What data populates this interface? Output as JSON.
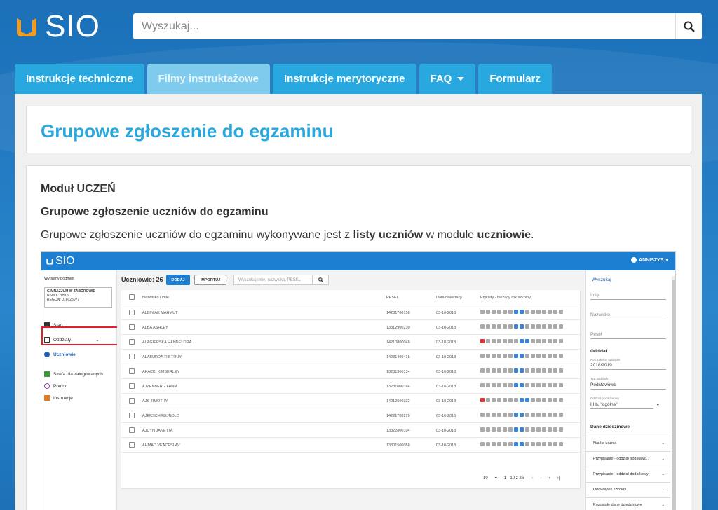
{
  "header": {
    "logo_text": "SIO",
    "search_placeholder": "Wyszukaj..."
  },
  "tabs": [
    {
      "label": "Instrukcje techniczne",
      "active": false
    },
    {
      "label": "Filmy instruktażowe",
      "active": true
    },
    {
      "label": "Instrukcje merytoryczne",
      "active": false
    },
    {
      "label": "FAQ",
      "active": false
    },
    {
      "label": "Formularz",
      "active": false
    }
  ],
  "page": {
    "title": "Grupowe zgłoszenie do egzaminu",
    "heading": "Moduł UCZEŃ",
    "subheading": "Grupowe zgłoszenie uczniów do egzaminu",
    "paragraph_start": "Grupowe zgłoszenie uczniów do egzaminu wykonywane jest z ",
    "paragraph_bold1": "listy uczniów",
    "paragraph_mid": " w module ",
    "paragraph_bold2": "uczniowie",
    "paragraph_end": "."
  },
  "screenshot": {
    "logo": "SIO",
    "user": "ANNISZYS",
    "side_label": "Wybrany podmiot",
    "school_name": "GIMNAZJUM W ZABOROWIE",
    "rspo": "RSPO: 20515",
    "regon": "REGON: 016025077",
    "nav": [
      "Start",
      "Oddziały",
      "Uczniowie",
      "Strefa dla zalogowanych",
      "Pomoc",
      "Instrukcje"
    ],
    "count": "Uczniowie: 26",
    "btn_add": "DODAJ",
    "btn_import": "IMPORTUJ",
    "search_placeholder": "Wyszukaj imię, nazwisko, PESEL",
    "columns": [
      "Nazwisko i imię",
      "PESEL",
      "Data rejestracji",
      "Etykiety - bieżący rok szkolny"
    ],
    "rows": [
      {
        "name": "ALBINIAK MAHMUT",
        "pesel": "14231700158",
        "date": "03-10-2018"
      },
      {
        "name": "ALBA ASHLEY",
        "pesel": "13312900230",
        "date": "03-10-2018"
      },
      {
        "name": "ALAGIERSKA HANNELORA",
        "pesel": "14210800048",
        "date": "03-10-2018"
      },
      {
        "name": "ALABURDA THI THUY",
        "pesel": "14231400416",
        "date": "03-10-2018"
      },
      {
        "name": "AKACKI KIMBERLEY",
        "pesel": "13281300134",
        "date": "03-10-2018"
      },
      {
        "name": "AJZENBERG FANIA",
        "pesel": "13281000164",
        "date": "03-10-2018"
      },
      {
        "name": "AJS TIMOTHY",
        "pesel": "14212600332",
        "date": "03-10-2018"
      },
      {
        "name": "AJERSCH REJNOLD",
        "pesel": "14221700270",
        "date": "03-10-2018"
      },
      {
        "name": "AJDYN JANETTA",
        "pesel": "13322800104",
        "date": "03-10-2018"
      },
      {
        "name": "AHMAD VEACESLAV",
        "pesel": "13301500058",
        "date": "03-10-2018"
      }
    ],
    "page_size": "10",
    "range": "1 - 10 z 26",
    "right": {
      "search": "Wyszukaj",
      "f_imie": "Imię",
      "f_nazwisko": "Nazwisko",
      "f_pesel": "Pesel",
      "section": "Oddział",
      "rok_label": "Rok szkolny oddziału",
      "rok_value": "2018/2019",
      "typ_label": "Typ oddziału",
      "typ_value": "Podstawowe",
      "odd_label": "Oddział podstawowy",
      "odd_value": "III b, \"ogólne\"",
      "dane": "Dane dziedzinowe",
      "acc": [
        "Nauka ucznia",
        "Przypisanie - oddział podstawo...",
        "Przypisanie - oddział dodatkowy",
        "Obowiązek szkolny",
        "Pozostałe dane dziedzinowe"
      ]
    }
  },
  "colors": {
    "accent": "#29a8e0",
    "header_bg": "#1b70b8",
    "highlight": "#e0202a"
  }
}
